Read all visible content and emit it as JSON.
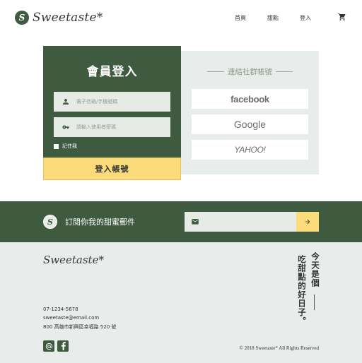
{
  "brand": {
    "logo_mark": "S",
    "name": "Sweetaste*"
  },
  "nav": {
    "home": "首頁",
    "desserts": "甜點",
    "login": "登入",
    "cart_icon": "cart-icon"
  },
  "login": {
    "title": "會員登入",
    "email_placeholder": "電子信箱/手機號碼",
    "password_placeholder": "請輸入使用者密碼",
    "remember_label": "記住我",
    "submit_label": "登入帳號"
  },
  "social": {
    "title": "連結社群帳號",
    "facebook": "facebook",
    "google": "Google",
    "yahoo": "YAHOO!"
  },
  "newsletter": {
    "badge": "S",
    "text": "訂閱你我的甜蜜郵件",
    "email_placeholder": "",
    "mail_icon": "mail-icon",
    "submit_icon": "arrow-right-icon"
  },
  "footer": {
    "logo": "Sweetaste*",
    "phone": "07-1234-5678",
    "email": "sweetaste@email.com",
    "address": "800 高雄市新興區幸福路 520 號",
    "tagline_col1": "今天是個",
    "tagline_col2": "吃甜點的好日子。",
    "copyright": "© 2018 Sweetaste* All Rights Reserved"
  },
  "colors": {
    "primary_green": "#3e5a3f",
    "accent_yellow": "#fcdc7a",
    "light_gray": "#e8ecea"
  }
}
